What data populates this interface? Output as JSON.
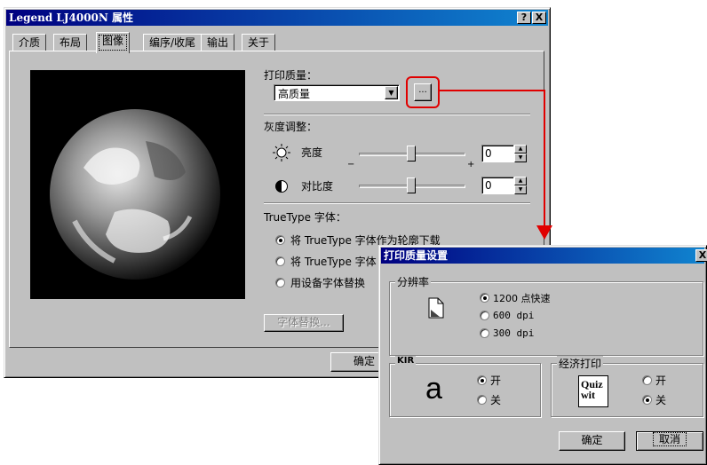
{
  "main_window": {
    "title": "Legend LJ4000N 属性",
    "title_buttons": [
      "?",
      "X"
    ],
    "tabs": [
      "介质",
      "布局",
      "图像",
      "编序/收尾",
      "输出",
      "关于"
    ],
    "active_tab": "图像",
    "print_quality_label": "打印质量：",
    "print_quality_value": "高质量",
    "ellipsis_button": "...",
    "grayscale_label": "灰度调整：",
    "brightness_label": "亮度",
    "brightness_value": "0",
    "contrast_label": "对比度",
    "contrast_value": "0",
    "slider_minus": "−",
    "slider_plus": "+",
    "truetype_label": "TrueType 字体：",
    "truetype_options": [
      "将 TrueType 字体作为轮廓下载",
      "将 TrueType 字体",
      "用设备字体替换"
    ],
    "font_substitution_button": "字体替换...",
    "ok_button": "确定"
  },
  "dialog": {
    "title": "打印质量设置",
    "close": "X",
    "resolution_group": "分辨率",
    "resolution_options": [
      "1200 点快速",
      "600 dpi",
      "300 dpi"
    ],
    "kir_group": "KIR",
    "kir_glyph": "a",
    "kir_options": [
      "开",
      "关"
    ],
    "economy_group": "经济打印",
    "economy_glyph": "Quiz wit",
    "economy_options": [
      "开",
      "关"
    ],
    "ok_button": "确定",
    "cancel_button": "取消"
  },
  "colors": {
    "accent_red": "#e00000",
    "title_blue": "#000080"
  }
}
